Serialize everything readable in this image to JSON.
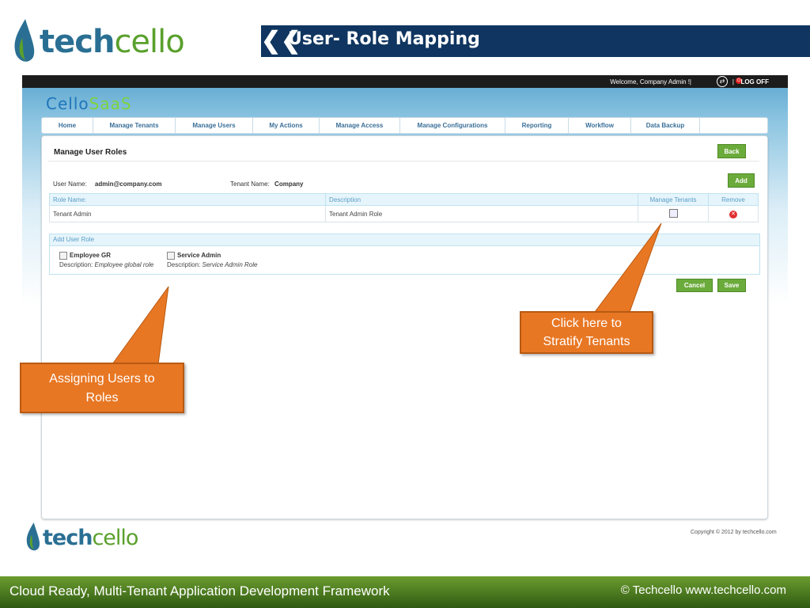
{
  "slide": {
    "logo": {
      "part1": "tech",
      "part2": "cello"
    },
    "title": "User- Role Mapping",
    "footer_left": "Cloud Ready, Multi-Tenant Application Development Framework",
    "footer_right": "© Techcello www.techcello.com"
  },
  "app": {
    "topbar": {
      "welcome": "Welcome, Company Admin  !",
      "separator": "|",
      "logoff": "LOG OFF"
    },
    "brand": {
      "part1": "Cello",
      "part2": "SaaS"
    },
    "nav": [
      "Home",
      "Manage Tenants",
      "Manage Users",
      "My Actions",
      "Manage Access",
      "Manage Configurations",
      "Reporting",
      "Workflow",
      "Data Backup"
    ],
    "panel": {
      "title": "Manage User Roles",
      "back_label": "Back",
      "add_label": "Add",
      "user_name_label": "User Name:",
      "user_name_value": "admin@company.com",
      "tenant_name_label": "Tenant Name:",
      "tenant_name_value": "Company",
      "table": {
        "headers": [
          "Role Name:",
          "Description",
          "Manage Tenants",
          "Remove"
        ],
        "rows": [
          {
            "role": "Tenant Admin",
            "description": "Tenant Admin Role"
          }
        ]
      },
      "add_user_role": {
        "header": "Add User Role",
        "roles": [
          {
            "name": "Employee GR",
            "desc_label": "Description:",
            "desc": "Employee global role"
          },
          {
            "name": "Service Admin",
            "desc_label": "Description:",
            "desc": "Service Admin Role"
          }
        ]
      },
      "cancel_label": "Cancel",
      "save_label": "Save"
    },
    "copyright": "Copyright © 2012 by techcello.com"
  },
  "callouts": {
    "assign": "Assigning Users to Roles",
    "stratify": "Click here to Stratify Tenants"
  },
  "colors": {
    "title_bar": "#0f3560",
    "callout": "#e87724",
    "green_button": "#6bab3b",
    "footer": "#4a7a1f"
  }
}
